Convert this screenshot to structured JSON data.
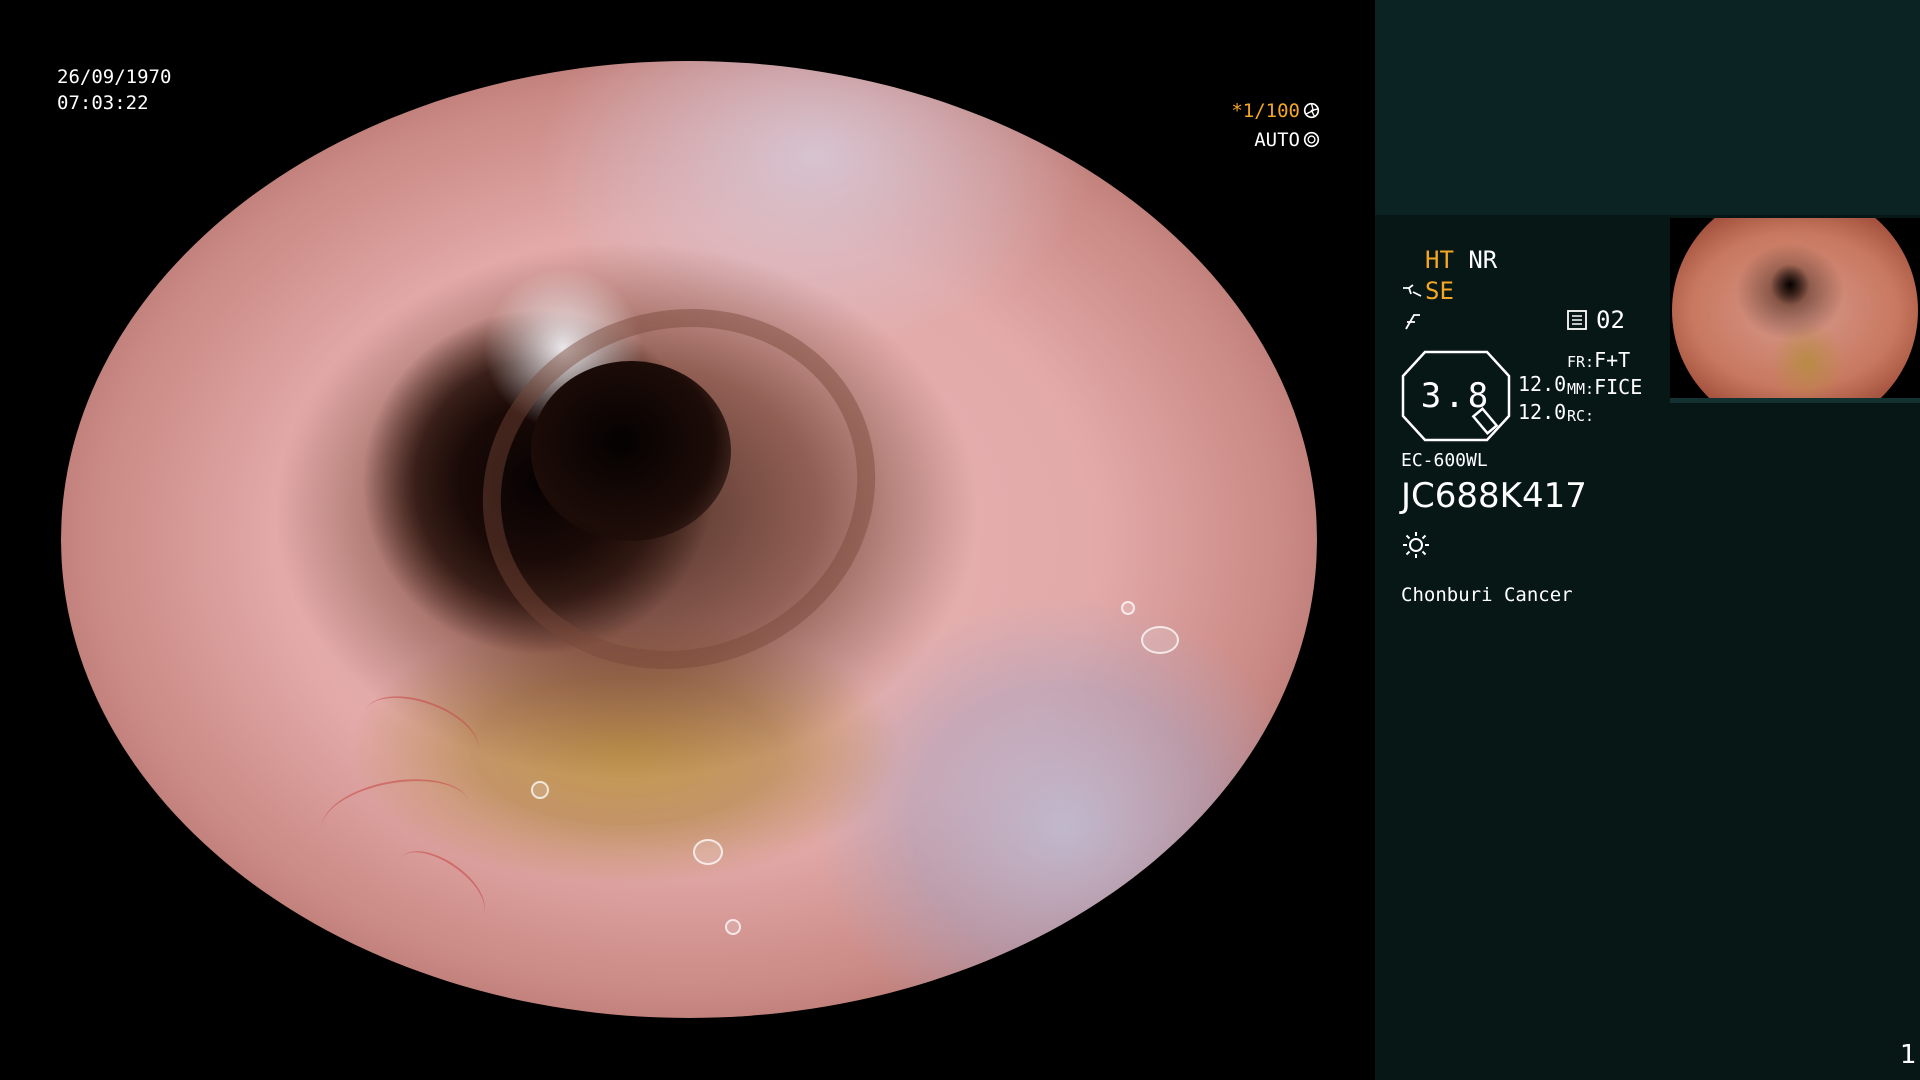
{
  "overlay": {
    "date": "26/09/1970",
    "time": "07:03:22",
    "shutter": "*1/100",
    "iris_mode": "AUTO"
  },
  "panel": {
    "ht": "HT",
    "nr": "NR",
    "se": "SE",
    "image_number": "02",
    "zoom": "3.8",
    "zoom_values": [
      "12.0",
      "12.0"
    ],
    "fr_label": "FR:",
    "fr_value": "F+T",
    "mm_label": "MM:",
    "mm_value": "FICE",
    "rc_label": "RC:",
    "rc_value": "",
    "scope_model": "EC-600WL",
    "scope_serial": "JC688K417",
    "hospital": "Chonburi Cancer",
    "page_number": "1"
  },
  "colors": {
    "accent_orange": "#f5a623",
    "panel_bg": "#061716",
    "panel_top_bg": "#0b2423",
    "text": "#ffffff"
  },
  "icons": {
    "shutter": "shutter-icon",
    "iris": "iris-icon",
    "enhance": "enhance-icon",
    "filter": "filter-icon",
    "memory": "memory-icon",
    "light": "light-icon"
  }
}
